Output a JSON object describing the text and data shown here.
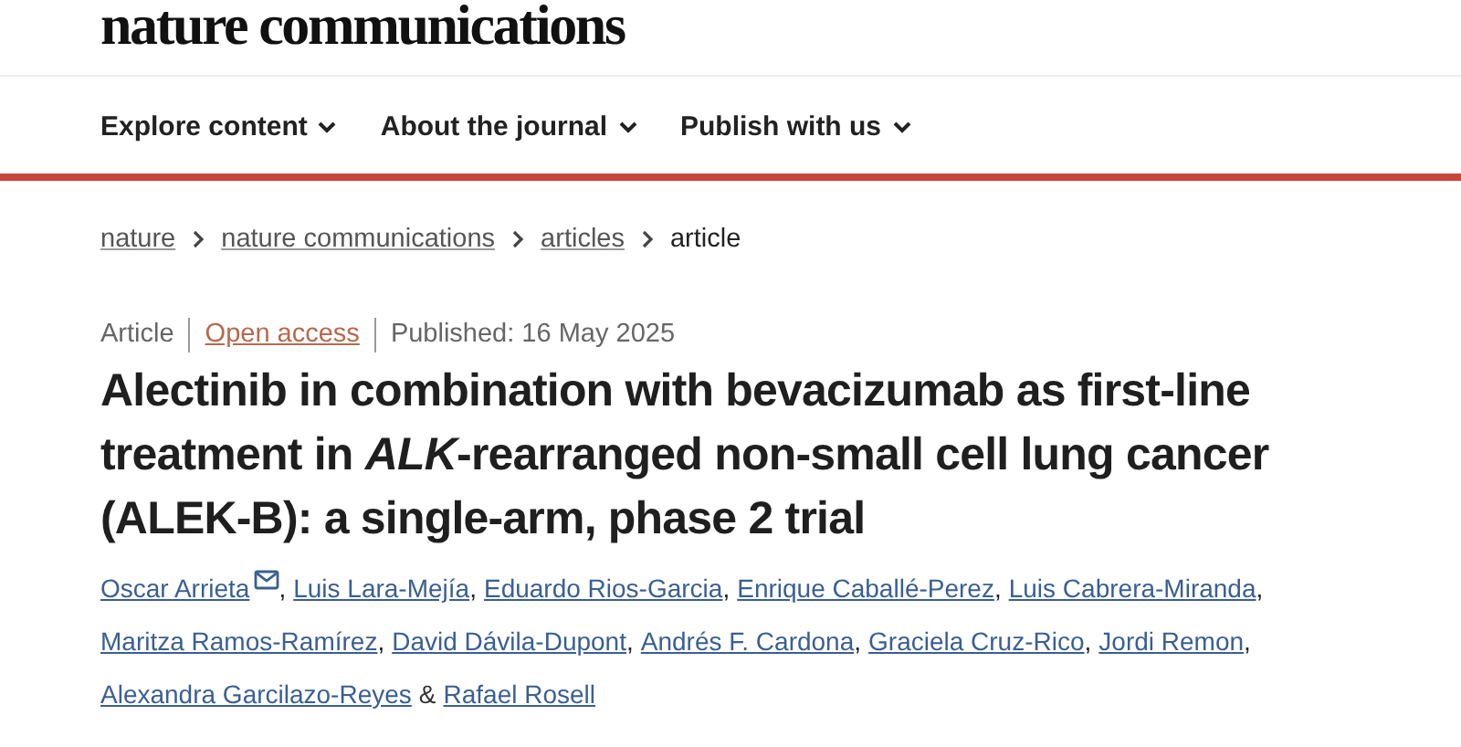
{
  "logo": "nature communications",
  "nav": [
    {
      "label": "Explore content"
    },
    {
      "label": "About the journal"
    },
    {
      "label": "Publish with us"
    }
  ],
  "breadcrumbs": [
    {
      "label": "nature",
      "link": true
    },
    {
      "label": "nature communications",
      "link": true
    },
    {
      "label": "articles",
      "link": true
    },
    {
      "label": "article",
      "link": false
    }
  ],
  "meta": {
    "type": "Article",
    "access": "Open access",
    "published": "Published: 16 May 2025"
  },
  "title": "Alectinib in combination with bevacizumab as first-line treatment in *ALK*-rearranged non-small cell lung cancer (ALEK-B): a single-arm, phase 2 trial",
  "authors": [
    {
      "name": "Oscar Arrieta",
      "email": true,
      "sep": ","
    },
    {
      "name": "Luis Lara-Mejía",
      "email": false,
      "sep": ","
    },
    {
      "name": "Eduardo Rios-Garcia",
      "email": false,
      "sep": ","
    },
    {
      "name": "Enrique Caballé-Perez",
      "email": false,
      "sep": ","
    },
    {
      "name": "Luis Cabrera-Miranda",
      "email": false,
      "sep": ","
    },
    {
      "name": "Maritza Ramos-Ramírez",
      "email": false,
      "sep": ","
    },
    {
      "name": "David Dávila-Dupont",
      "email": false,
      "sep": ","
    },
    {
      "name": "Andrés F. Cardona",
      "email": false,
      "sep": ","
    },
    {
      "name": "Graciela Cruz-Rico",
      "email": false,
      "sep": ","
    },
    {
      "name": "Jordi Remon",
      "email": false,
      "sep": ","
    },
    {
      "name": "Alexandra Garcilazo-Reyes",
      "email": false,
      "sep": "&"
    },
    {
      "name": "Rafael Rosell",
      "email": false
    }
  ]
}
